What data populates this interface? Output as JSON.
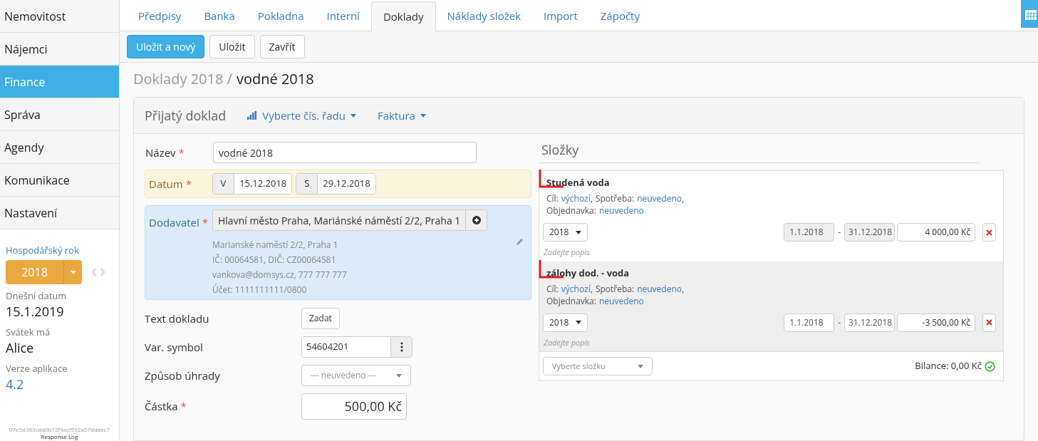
{
  "sidebar": {
    "items": [
      {
        "label": "Nemovitost",
        "selected": false
      },
      {
        "label": "Nájemci",
        "selected": false
      },
      {
        "label": "Finance",
        "selected": true
      },
      {
        "label": "Správa",
        "selected": false
      },
      {
        "label": "Agendy",
        "selected": false
      },
      {
        "label": "Komunikace",
        "selected": false
      },
      {
        "label": "Nastavení",
        "selected": false
      }
    ],
    "fiscal_year_label": "Hospodářský rok",
    "fiscal_year": "2018",
    "info": [
      {
        "label": "Dnešní datum",
        "value": "15.1.2019",
        "kind": "text"
      },
      {
        "label": "Svátek má",
        "value": "Alice",
        "kind": "text"
      },
      {
        "label": "Verze aplikace",
        "value": "4.2",
        "kind": "link"
      }
    ],
    "hash": "07e5d383cda0b72f9acf592a57ddaec7",
    "footer_link": "Response Log"
  },
  "tabs": [
    {
      "label": "Předpisy",
      "selected": false
    },
    {
      "label": "Banka",
      "selected": false
    },
    {
      "label": "Pokladna",
      "selected": false
    },
    {
      "label": "Interní",
      "selected": false
    },
    {
      "label": "Doklady",
      "selected": true
    },
    {
      "label": "Náklady složek",
      "selected": false
    },
    {
      "label": "Import",
      "selected": false
    },
    {
      "label": "Zápočty",
      "selected": false
    }
  ],
  "toolbar": [
    {
      "label": "Uložit a nový",
      "kind": "primary"
    },
    {
      "label": "Uložit",
      "kind": "default"
    },
    {
      "label": "Zavřít",
      "kind": "default"
    }
  ],
  "breadcrumb": {
    "parent": "Doklady 2018 /",
    "current": "vodné 2018"
  },
  "panel": {
    "title": "Přijatý doklad",
    "menus": [
      {
        "label": "Vyberte čís. řadu"
      },
      {
        "label": "Faktura"
      }
    ]
  },
  "form": {
    "name": {
      "label": "Název",
      "value": "vodné 2018"
    },
    "date": {
      "label": "Datum",
      "from_prefix": "V",
      "from": "15.12.2018",
      "to_prefix": "S",
      "to": "29.12.2018"
    },
    "supplier": {
      "label": "Dodavatel",
      "value": "Hlavní město Praha, Mariánské náměstí 2/2, Praha 1",
      "details": [
        "Marianské naměstí 2/2, Praha 1",
        "IČ: 00064581, DIČ: CZ00064581",
        "vankova@domsys.cz, 777 777 777",
        "Účet: 1111111111/0800"
      ]
    },
    "text": {
      "label": "Text dokladu",
      "button": "Zadat"
    },
    "var_symbol": {
      "label": "Var. symbol",
      "value": "54604201"
    },
    "payment": {
      "label": "Způsob úhrady",
      "placeholder": "--- neuvedeno ---"
    },
    "amount": {
      "label": "Částka",
      "value": "500,00 Kč"
    },
    "required_mark": "*"
  },
  "folders": {
    "title": "Složky",
    "items": [
      {
        "name": "Studená voda",
        "target_label": "Cíl:",
        "target": "výchozí",
        "target_suffix": ",",
        "consumption_label": "Spotřeba:",
        "consumption": "neuvedeno",
        "consumption_suffix": ",",
        "order_label": "Objednavka:",
        "order": "neuvedeno",
        "year": "2018",
        "from": "1.1.2018",
        "range_separator": "-",
        "to": "31.12.2018",
        "dates_disabled": true,
        "amount": "4 000,00 Kč",
        "note_placeholder": "Zadejte popis",
        "highlighted": false
      },
      {
        "name": "zálohy dod. - voda",
        "target_label": "Cíl:",
        "target": "výchozí",
        "target_suffix": ",",
        "consumption_label": "Spotřeba:",
        "consumption": "neuvedeno",
        "consumption_suffix": ",",
        "order_label": "Objednavka:",
        "order": "neuvedeno",
        "year": "2018",
        "from": "1.1.2018",
        "range_separator": "-",
        "to": "31.12.2018",
        "dates_disabled": false,
        "amount": "-3 500,00 Kč",
        "note_placeholder": "Zadejte popis",
        "highlighted": true
      }
    ],
    "select_placeholder": "Vyberte složku",
    "balance": "Bilance: 0,00 Kč",
    "balance_ok": true
  }
}
